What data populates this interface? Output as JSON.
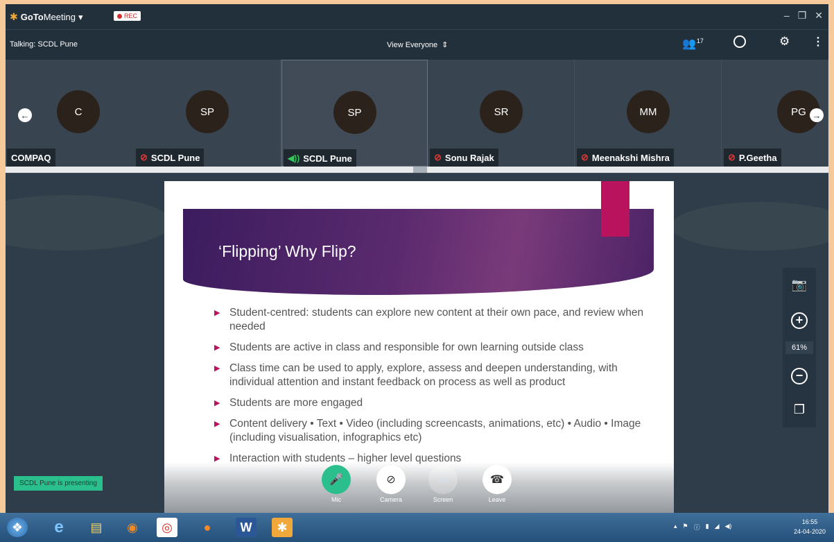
{
  "titlebar": {
    "app_prefix": "GoTo",
    "app_name": "Meeting",
    "rec_label": "REC",
    "min_glyph": "–",
    "max_glyph": "❐",
    "close_glyph": "✕"
  },
  "infobar": {
    "talking": "Talking: SCDL Pune",
    "view_label": "View Everyone",
    "participant_count": "17"
  },
  "participants": [
    {
      "initials": "C",
      "name": "COMPAQ",
      "status": "none"
    },
    {
      "initials": "SP",
      "name": "SCDL Pune",
      "status": "muted"
    },
    {
      "initials": "SP",
      "name": "SCDL Pune",
      "status": "speaking"
    },
    {
      "initials": "SR",
      "name": "Sonu Rajak",
      "status": "muted"
    },
    {
      "initials": "MM",
      "name": "Meenakshi Mishra",
      "status": "muted"
    },
    {
      "initials": "PG",
      "name": "P.Geetha",
      "status": "muted"
    }
  ],
  "slide": {
    "title": "‘Flipping’ Why Flip?",
    "bullets": [
      "Student-centred: students can explore new content at their own pace, and review when needed",
      "Students are active in class and responsible for own learning outside class",
      "Class time can be used to apply, explore, assess and deepen understanding, with individual attention and instant feedback on process as well as product",
      "Students are more engaged",
      "Content delivery • Text • Video (including screencasts, animations, etc) • Audio • Image (including visualisation, infographics etc)",
      "Interaction with students – higher level questions"
    ]
  },
  "zoom": {
    "level": "61%"
  },
  "presenting": "SCDL Pune is presenting",
  "controls": {
    "mic": "Mic",
    "camera": "Camera",
    "screen": "Screen",
    "leave": "Leave"
  },
  "taskbar": {
    "time": "16:55",
    "date": "24-04-2020"
  },
  "colors": {
    "accent_green": "#2bbf8e",
    "slide_accent": "#b8135c",
    "mute_red": "#e53935"
  }
}
